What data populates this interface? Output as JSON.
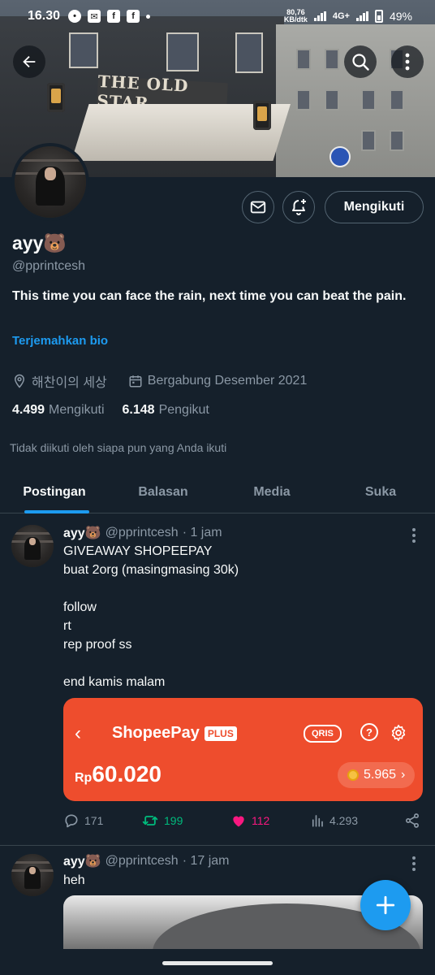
{
  "status_bar": {
    "time": "16.30",
    "speed_top": "80,76",
    "speed_bottom": "KB/dtk",
    "network": "4G+",
    "battery": "49%"
  },
  "banner": {
    "sign_text": "THE OLD STAR"
  },
  "profile": {
    "name": "ayy🐻",
    "handle": "@pprintcesh",
    "bio": "This time you can face the rain, next time you can beat the pain.",
    "translate_label": "Terjemahkan bio",
    "location": "해찬이의 세상",
    "joined": "Bergabung Desember 2021",
    "following_count": "4.499",
    "following_label": "Mengikuti",
    "followers_count": "6.148",
    "followers_label": "Pengikut",
    "not_followed_text": "Tidak diikuti oleh siapa pun yang Anda ikuti",
    "follow_button": "Mengikuti"
  },
  "tabs": [
    {
      "label": "Postingan",
      "active": true
    },
    {
      "label": "Balasan",
      "active": false
    },
    {
      "label": "Media",
      "active": false
    },
    {
      "label": "Suka",
      "active": false
    }
  ],
  "tweets": [
    {
      "name": "ayy🐻",
      "handle": "@pprintcesh",
      "time": "· 1 jam",
      "lines": [
        "GIVEAWAY SHOPEEPAY",
        "buat 2org (masingmasing 30k)",
        "",
        "follow",
        "rt",
        "rep proof ss",
        "",
        "end kamis malam"
      ],
      "card": {
        "brand": "ShopeePay",
        "plus": "PLUS",
        "qris": "QRIS",
        "help": "?",
        "currency": "Rp",
        "balance": "60.020",
        "coins": "5.965",
        "coins_chevron": "›",
        "back": "‹"
      },
      "replies": "171",
      "retweets": "199",
      "likes": "112",
      "views": "4.293"
    },
    {
      "name": "ayy🐻",
      "handle": "@pprintcesh",
      "time": "· 17 jam",
      "lines": [
        "heh"
      ]
    }
  ],
  "colors": {
    "background": "#15202b",
    "accent": "#1d9bf0",
    "retweet": "#00ba7c",
    "like": "#f91880",
    "shopee": "#ee4d2d"
  }
}
